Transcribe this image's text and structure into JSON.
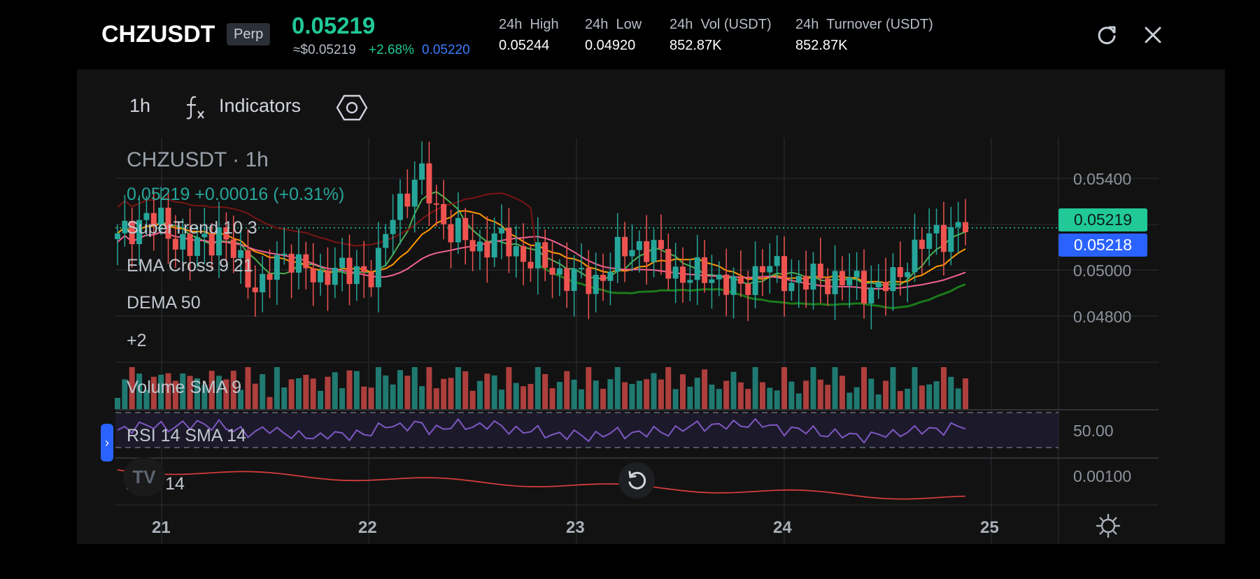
{
  "header": {
    "symbol": "CHZUSDT",
    "contract_type": "Perp",
    "last_price": "0.05219",
    "usd_price": "≈$0.05219",
    "change_pct": "+2.68%",
    "mark_price": "0.05220",
    "stats": [
      {
        "label": "24h  High",
        "value": "0.05244"
      },
      {
        "label": "24h  Low",
        "value": "0.04920"
      },
      {
        "label": "24h  Vol (USDT)",
        "value": "852.87K"
      },
      {
        "label": "24h  Turnover (USDT)",
        "value": "852.87K"
      }
    ],
    "refresh_icon": "refresh-icon",
    "close_icon": "close-icon"
  },
  "toolbar": {
    "interval": "1h",
    "indicators_icon": "function-icon",
    "indicators_label": "Indicators",
    "settings_icon": "hexagon-settings-icon"
  },
  "overlay": {
    "title": "CHZUSDT · 1h",
    "price_line": "0.05219 +0.00016 (+0.31%)",
    "indicators": [
      "SuperTrend 10 3",
      "EMA Cross 9 21",
      "DEMA 50",
      "+2"
    ],
    "volume_label": "Volume SMA 9",
    "rsi_label": "RSI 14 SMA 14",
    "atr_label": "ATR 14"
  },
  "price_tags": {
    "last": "0.05219",
    "mark": "0.05218"
  },
  "y_axis": {
    "price_ticks": [
      "0.05400",
      "0.05000",
      "0.04800"
    ],
    "rsi_tick": "50.00",
    "atr_tick": "0.00100"
  },
  "x_axis": {
    "ticks": [
      "21",
      "22",
      "23",
      "24",
      "25"
    ]
  },
  "controls": {
    "reset_icon": "reset-icon",
    "chart_settings_icon": "sun-settings-icon",
    "collapse_icon": "chevron-right-icon",
    "logo": "TV"
  },
  "colors": {
    "up": "#26a69a",
    "down": "#ef5350",
    "accent": "#20c997",
    "mark": "#2962ff",
    "rsi": "#7e57c2"
  },
  "chart_data": {
    "type": "candlestick",
    "interval": "1h",
    "x_range": [
      "21",
      "25"
    ],
    "price_range": [
      0.0475,
      0.0553
    ],
    "last_price": 0.05219,
    "mark_price": 0.05218,
    "close_path": [
      0.05175,
      0.05225,
      0.0526,
      0.0523,
      0.0519,
      0.0514,
      0.0517,
      0.0521,
      0.0513,
      0.0506,
      0.0501,
      0.0509,
      0.0514,
      0.0507,
      0.0502,
      0.0511,
      0.0504,
      0.0507,
      0.0508,
      0.0524,
      0.0534,
      0.0541,
      0.0529,
      0.0523,
      0.0518,
      0.0514,
      0.0519,
      0.0516,
      0.0513,
      0.0511,
      0.0508,
      0.0506,
      0.0504,
      0.0503,
      0.0507,
      0.0513,
      0.0517,
      0.0514,
      0.0511,
      0.0506,
      0.0504,
      0.0507,
      0.0504,
      0.0499,
      0.0505,
      0.0509,
      0.0506,
      0.0504,
      0.0503,
      0.0505,
      0.0504,
      0.0503,
      0.0502,
      0.0501,
      0.0503,
      0.0512,
      0.0516,
      0.052,
      0.0521,
      0.05219
    ]
  }
}
